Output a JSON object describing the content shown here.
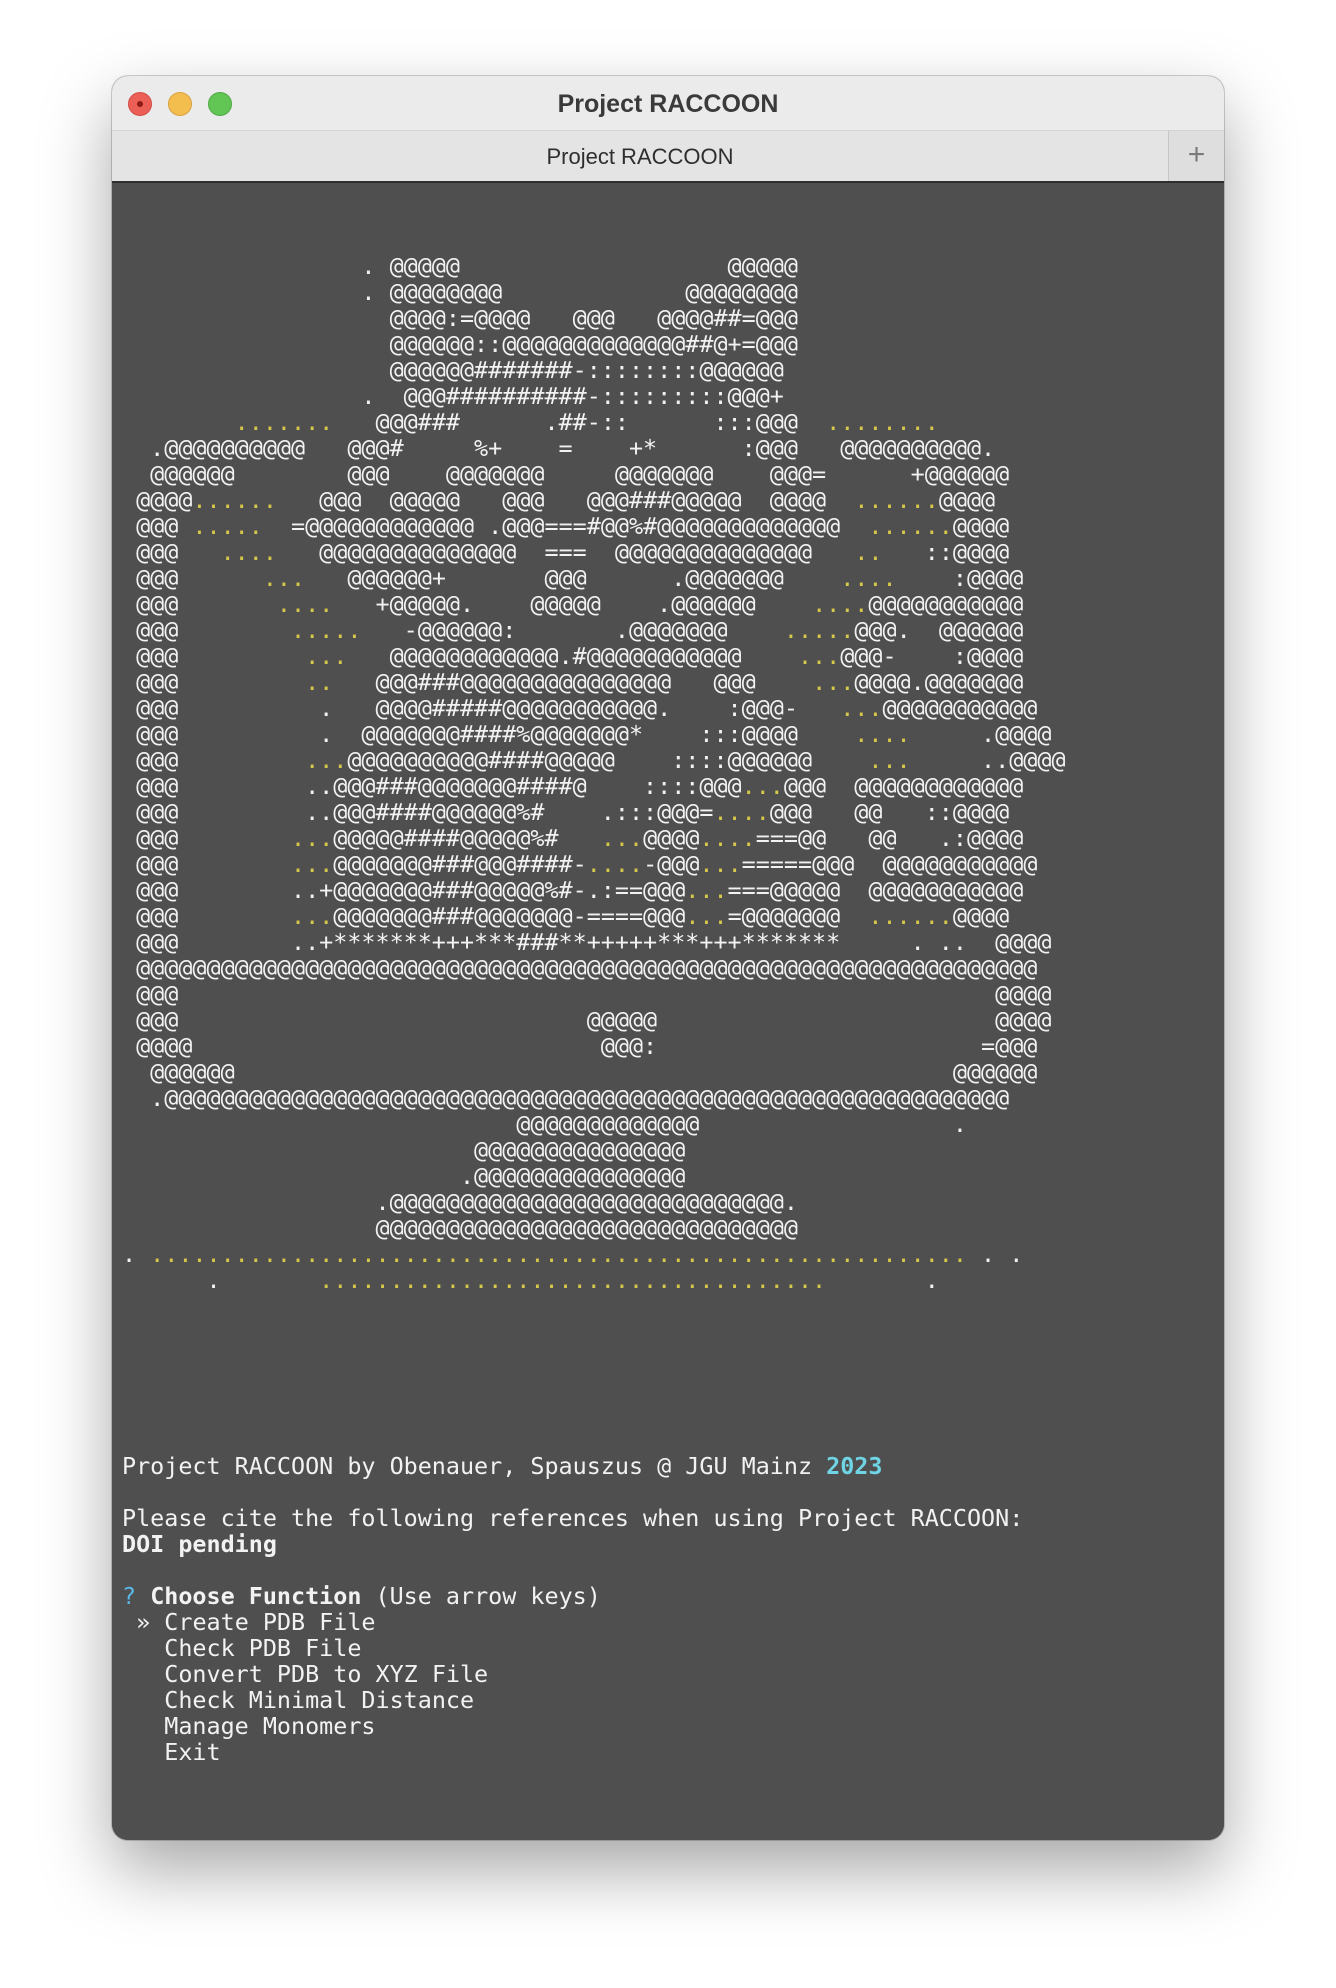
{
  "window": {
    "title": "Project RACCOON",
    "tab_label": "Project RACCOON",
    "new_tab_symbol": "+"
  },
  "terminal": {
    "credit_prefix": "Project RACCOON by Obenauer, Spauszus @ JGU Mainz ",
    "credit_year": "2023",
    "cite_text": "Please cite the following references when using Project RACCOON:",
    "doi": "DOI pending",
    "prompt_symbol": "?",
    "prompt_label": "Choose Function",
    "prompt_hint": " (Use arrow keys)",
    "selection_marker": "»",
    "menu": [
      "Create PDB File",
      "Check PDB File",
      "Convert PDB to XYZ File",
      "Check Minimal Distance",
      "Manage Monomers",
      "Exit"
    ]
  }
}
